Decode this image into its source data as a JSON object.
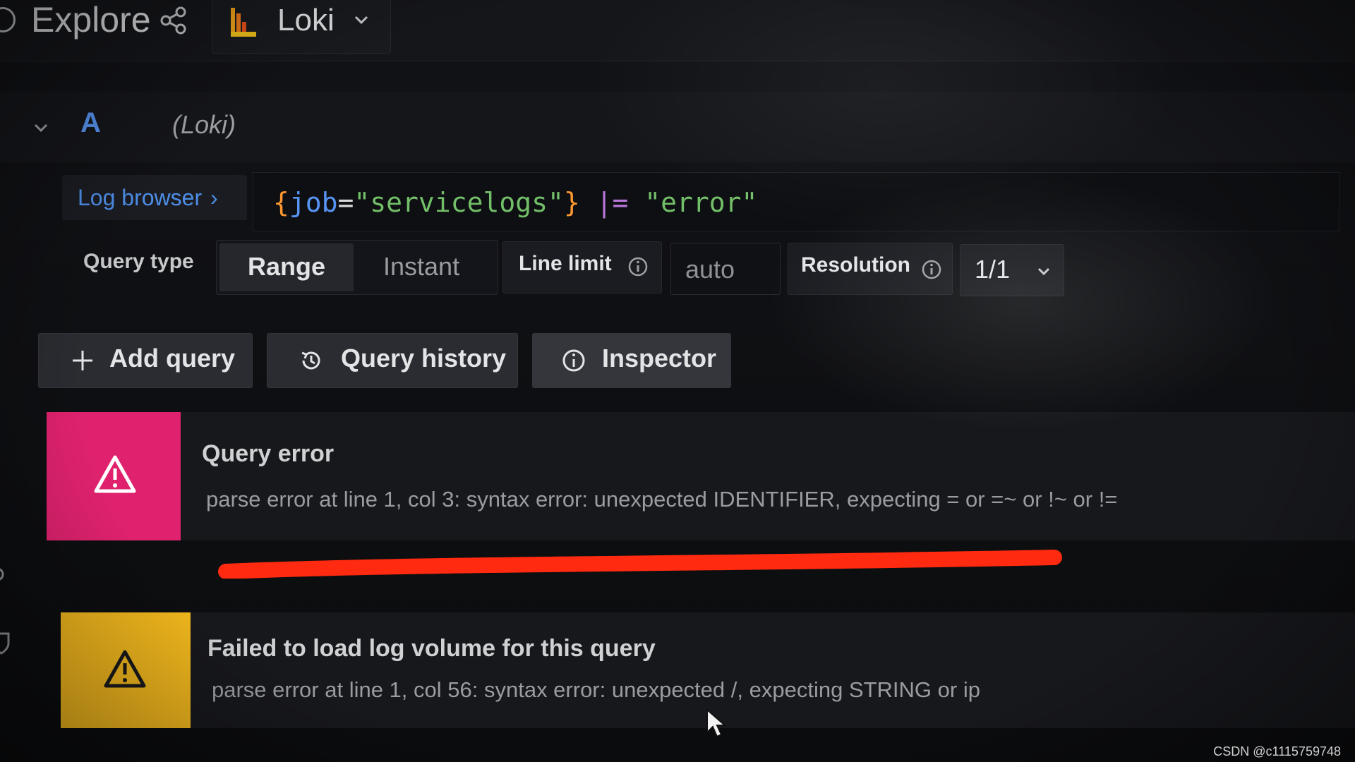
{
  "header": {
    "title": "Explore",
    "datasource": {
      "name": "Loki"
    }
  },
  "query_row": {
    "letter": "A",
    "datasource_label": "(Loki)"
  },
  "editor": {
    "log_browser_label": "Log browser",
    "log_browser_chevron": "›",
    "query_tokens": {
      "open_brace": "{",
      "label": "job",
      "equals": "=",
      "label_value": "\"servicelogs\"",
      "close_brace": "}",
      "filter_op": " |= ",
      "filter_value": "\"error\""
    }
  },
  "options": {
    "query_type_label": "Query type",
    "query_types": [
      "Range",
      "Instant"
    ],
    "selected_query_type": "Range",
    "line_limit_label": "Line limit",
    "line_limit_placeholder": "auto",
    "resolution_label": "Resolution",
    "resolution_value": "1/1"
  },
  "actions": {
    "add_query": "Add query",
    "query_history": "Query history",
    "inspector": "Inspector"
  },
  "alerts": [
    {
      "severity": "error",
      "title": "Query error",
      "message": "parse error at line 1, col 3: syntax error: unexpected IDENTIFIER, expecting = or =~ or !~ or !="
    },
    {
      "severity": "warning",
      "title": "Failed to load log volume for this query",
      "message": "parse error at line 1, col 56: syntax error: unexpected /, expecting STRING or ip"
    }
  ],
  "watermark": "CSDN @c1115759748",
  "colors": {
    "accent_blue": "#5794f2",
    "error": "#e0226e",
    "warning": "#f0b61d",
    "string_green": "#73bf69",
    "brace_orange": "#ff9830",
    "operator_purple": "#b877d9",
    "annotation_red": "#ff2a10"
  },
  "icons": {
    "share": "share-icon",
    "loki_logo": "loki-logo-icon",
    "chevron": "chevron-down-icon",
    "info": "info-icon",
    "plus": "plus-icon",
    "history": "history-icon",
    "alert": "warning-triangle-icon",
    "cursor": "mouse-cursor-icon"
  }
}
